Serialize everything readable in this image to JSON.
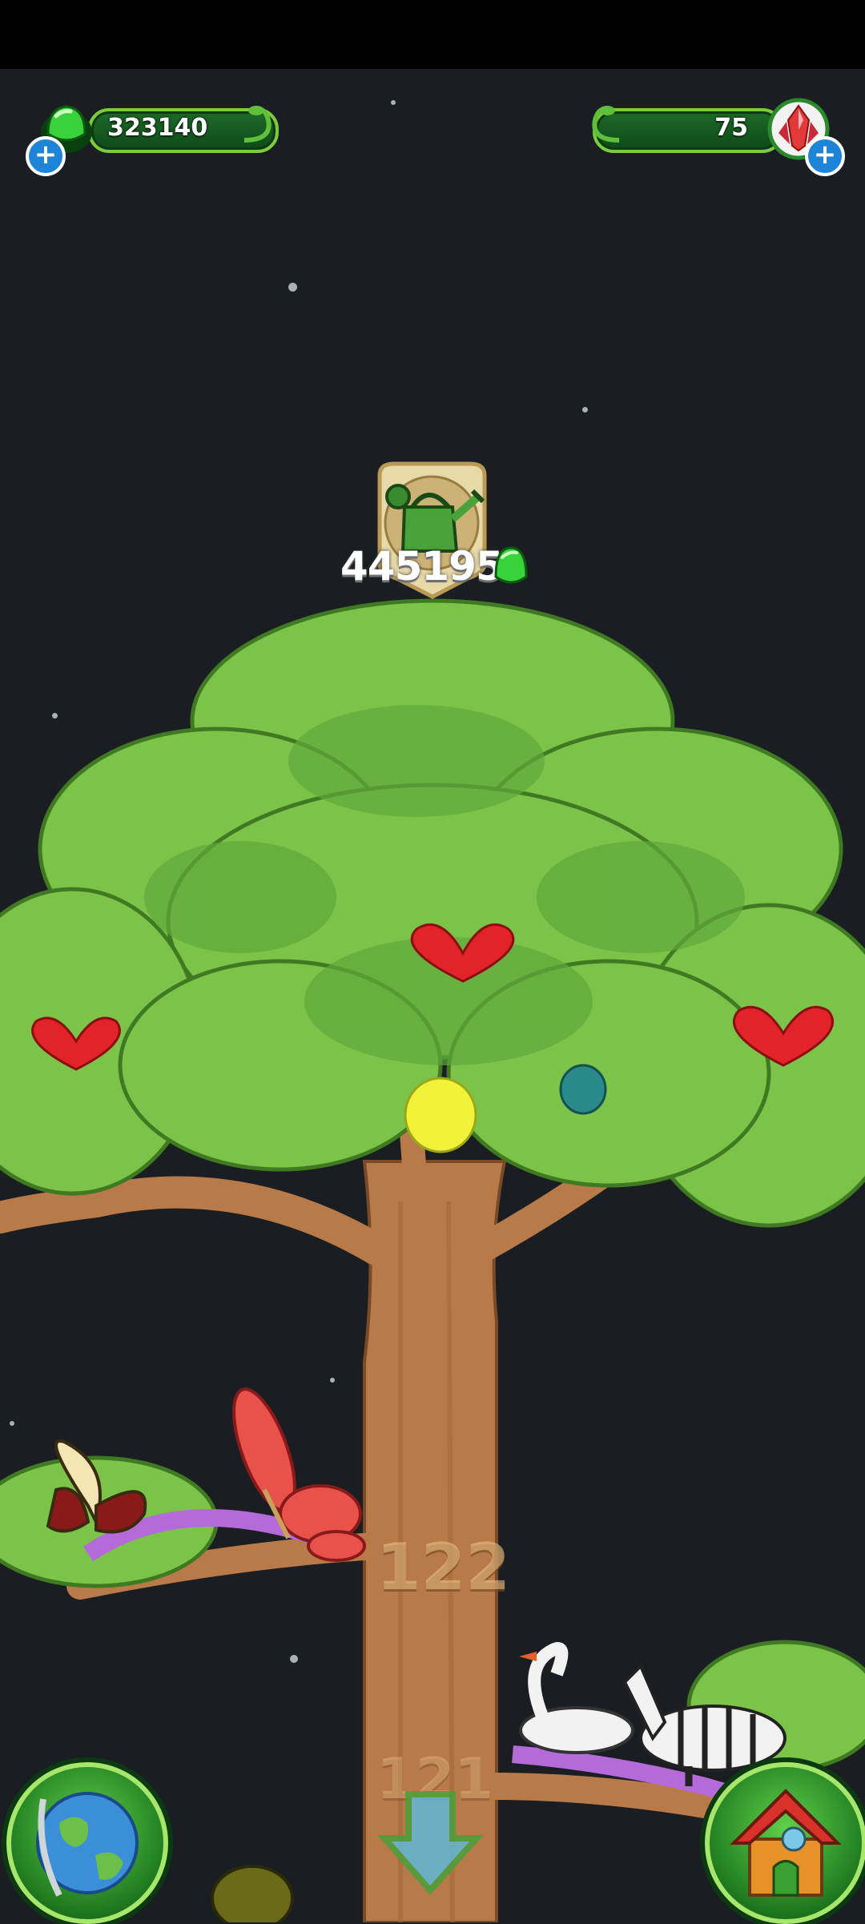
{
  "hud": {
    "currency_value": "323140",
    "gems_value": "75"
  },
  "tree": {
    "upgrade_cost": "445195",
    "levels": [
      "122",
      "121"
    ]
  },
  "icons": {
    "currency": "green-gem-icon",
    "gems": "red-crystal-icon",
    "upgrade": "watering-can-icon",
    "world": "globe-icon",
    "down": "down-arrow-icon",
    "home": "house-icon"
  },
  "colors": {
    "background": "#1a1e22",
    "accent_green": "#7ccb3c",
    "plus_blue": "#1e84d8"
  }
}
